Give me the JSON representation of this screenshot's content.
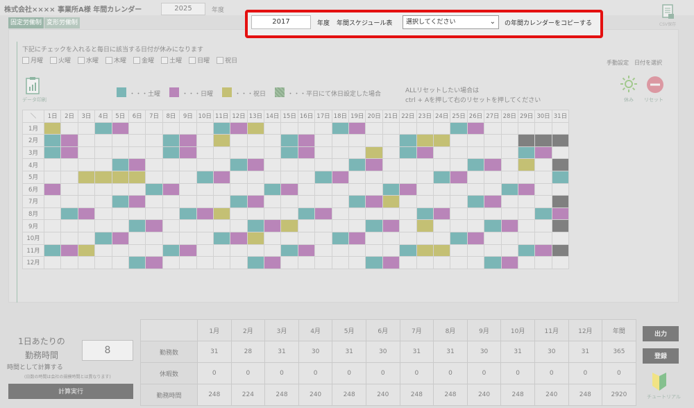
{
  "header": {
    "company": "株式会社×××× 事業所A様 年間カレンダー",
    "year": "2025",
    "nendo": "年度",
    "schedule_label": "年間スケジュール表"
  },
  "tabs": [
    "固定労働制",
    "変形労働制"
  ],
  "ribbon_icon_label": "CSV保存",
  "instructions": "下記にチェックを入れると毎日に該当する日付が休みになります",
  "weekday_checkboxes": [
    "月曜",
    "火曜",
    "水曜",
    "木曜",
    "金曜",
    "土曜",
    "日曜",
    "祝日"
  ],
  "manual_setting": "手動設定　日付を選択",
  "legend": {
    "saturday": "・・・土曜",
    "sunday": "・・・日曜",
    "holiday": "・・・祝日",
    "weekday_holiday": "・・・平日にて休日設定した場合",
    "colors": {
      "saturday": "#2a8a8a",
      "sunday": "#8e3a8e",
      "holiday": "#a19a20",
      "weekday_holiday": "#5a8a5a"
    }
  },
  "reset_note": [
    "ALLリセットしたい場合は",
    "ctrl + Aを押して右のリセットを押してください"
  ],
  "icons": {
    "data_print": "データ印刷",
    "holiday": "休み",
    "reset": "リセット"
  },
  "calendar": {
    "corner": "＼",
    "days": [
      "1日",
      "2日",
      "3日",
      "4日",
      "5日",
      "6日",
      "7日",
      "8日",
      "9日",
      "10日",
      "11日",
      "12日",
      "13日",
      "14日",
      "15日",
      "16日",
      "17日",
      "18日",
      "19日",
      "20日",
      "21日",
      "22日",
      "23日",
      "24日",
      "25日",
      "26日",
      "27日",
      "28日",
      "29日",
      "30日",
      "31日"
    ],
    "months": [
      "1月",
      "2月",
      "3月",
      "4月",
      "5月",
      "6月",
      "7月",
      "8月",
      "9月",
      "10月",
      "11月",
      "12月"
    ],
    "holidays": {
      "1": {
        "1": "hol",
        "4": "sat",
        "5": "sun",
        "11": "sat",
        "12": "sun",
        "13": "hol",
        "18": "sat",
        "19": "sun",
        "25": "sat",
        "26": "sun"
      },
      "2": {
        "1": "sat",
        "2": "sun",
        "8": "sat",
        "9": "sun",
        "11": "hol",
        "15": "sat",
        "16": "sun",
        "22": "sat",
        "23": "hol",
        "24": "hol",
        "29": "inv",
        "30": "inv",
        "31": "inv"
      },
      "3": {
        "1": "sat",
        "2": "sun",
        "8": "sat",
        "9": "sun",
        "15": "sat",
        "16": "sun",
        "20": "hol",
        "22": "sat",
        "23": "sun",
        "29": "sat",
        "30": "sun"
      },
      "4": {
        "5": "sat",
        "6": "sun",
        "12": "sat",
        "13": "sun",
        "19": "sat",
        "20": "sun",
        "26": "sat",
        "27": "sun",
        "29": "hol",
        "31": "inv"
      },
      "5": {
        "3": "hol",
        "4": "hol",
        "5": "hol",
        "6": "hol",
        "10": "sat",
        "11": "sun",
        "17": "sat",
        "18": "sun",
        "24": "sat",
        "25": "sun",
        "31": "sat"
      },
      "6": {
        "1": "sun",
        "7": "sat",
        "8": "sun",
        "14": "sat",
        "15": "sun",
        "21": "sat",
        "22": "sun",
        "28": "sat",
        "29": "sun"
      },
      "7": {
        "5": "sat",
        "6": "sun",
        "12": "sat",
        "13": "sun",
        "19": "sat",
        "20": "sun",
        "21": "hol",
        "26": "sat",
        "27": "sun",
        "31": "inv"
      },
      "8": {
        "2": "sat",
        "3": "sun",
        "9": "sat",
        "10": "sun",
        "11": "hol",
        "16": "sat",
        "17": "sun",
        "23": "sat",
        "24": "sun",
        "30": "sat",
        "31": "sun"
      },
      "9": {
        "6": "sat",
        "7": "sun",
        "13": "sat",
        "14": "sun",
        "15": "hol",
        "20": "sat",
        "21": "sun",
        "23": "hol",
        "27": "sat",
        "28": "sun",
        "31": "inv"
      },
      "10": {
        "4": "sat",
        "5": "sun",
        "11": "sat",
        "12": "sun",
        "13": "hol",
        "18": "sat",
        "19": "sun",
        "25": "sat",
        "26": "sun"
      },
      "11": {
        "1": "sat",
        "2": "sun",
        "3": "hol",
        "8": "sat",
        "9": "sun",
        "15": "sat",
        "16": "sun",
        "22": "sat",
        "23": "hol",
        "24": "hol",
        "29": "sat",
        "30": "sun",
        "31": "inv"
      },
      "12": {
        "6": "sat",
        "7": "sun",
        "13": "sat",
        "14": "sun",
        "20": "sat",
        "21": "sun",
        "27": "sat",
        "28": "sun"
      }
    }
  },
  "day_hours": {
    "title": [
      "1日あたりの",
      "勤務時間"
    ],
    "value": "8",
    "note": "時間として計算する",
    "sub_note": "(日数の時間は会社の規模時間とは異なります)",
    "calc_button": "計算実行"
  },
  "summary": {
    "headers": [
      "",
      "1月",
      "2月",
      "3月",
      "4月",
      "5月",
      "6月",
      "7月",
      "8月",
      "9月",
      "10月",
      "11月",
      "12月",
      "年間"
    ],
    "rows": [
      {
        "label": "勤務数",
        "values": [
          "31",
          "28",
          "31",
          "30",
          "31",
          "30",
          "31",
          "31",
          "30",
          "31",
          "30",
          "31",
          "365"
        ]
      },
      {
        "label": "休暇数",
        "values": [
          "0",
          "0",
          "0",
          "0",
          "0",
          "0",
          "0",
          "0",
          "0",
          "0",
          "0",
          "0",
          "0"
        ]
      },
      {
        "label": "勤務時間",
        "values": [
          "248",
          "224",
          "248",
          "240",
          "248",
          "240",
          "248",
          "248",
          "240",
          "248",
          "240",
          "248",
          "2920"
        ]
      }
    ]
  },
  "side_buttons": {
    "output": "出力",
    "register": "登録",
    "tutorial": "チュートリアル"
  },
  "popup": {
    "year": "2017",
    "nendo": "年度",
    "schedule_label": "年間スケジュール表",
    "select_value": "選択してください",
    "copy_label": "の年間カレンダーをコピーする"
  }
}
